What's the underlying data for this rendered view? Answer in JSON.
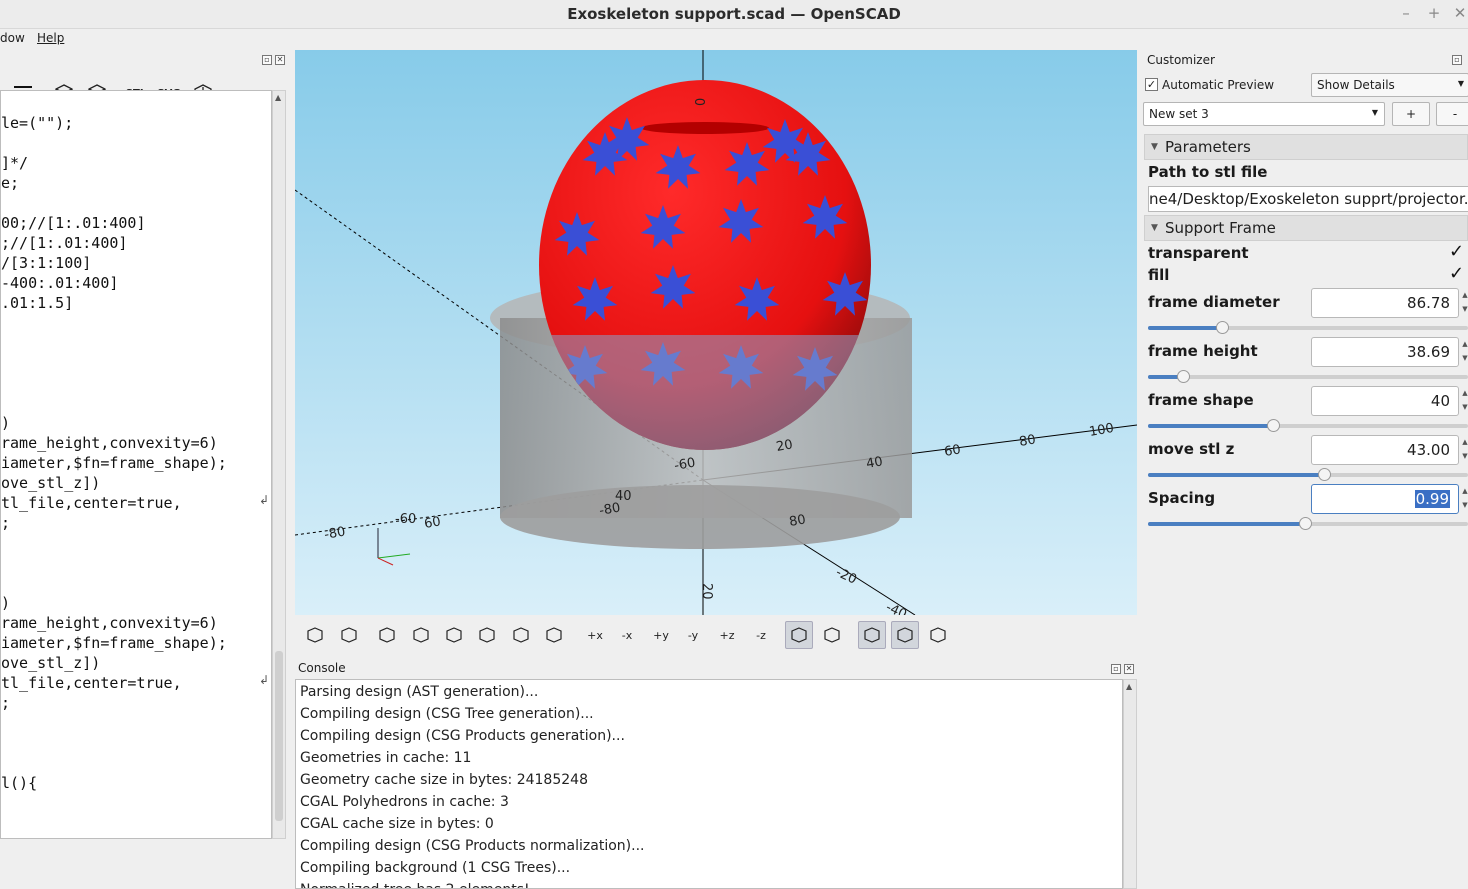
{
  "window": {
    "title": "Exoskeleton support.scad — OpenSCAD",
    "min_glyph": "–",
    "max_glyph": "+",
    "close_glyph": "✕"
  },
  "menu": {
    "items": [
      "dow",
      "Help"
    ]
  },
  "editor": {
    "toolbar": [
      "indent-icon",
      "preview-icon",
      "render-icon",
      "STL",
      "SVG",
      "send-icon"
    ],
    "lines": [
      "le=(\"\");",
      "",
      "]*/",
      "e;",
      "",
      "00;//[1:.01:400]",
      ";//[1:.01:400]",
      "/[3:1:100]",
      "-400:.01:400]",
      ".01:1.5]",
      "",
      "",
      "",
      "",
      "",
      ")",
      "rame_height,convexity=6)",
      "iameter,$fn=frame_shape);",
      "ove_stl_z])",
      "tl_file,center=true,",
      ";",
      "",
      "",
      "",
      ")",
      "rame_height,convexity=6)",
      "iameter,$fn=frame_shape);",
      "ove_stl_z])",
      "tl_file,center=true,",
      ";",
      "",
      "",
      "",
      "l(){"
    ],
    "wrap_glyph": "↲"
  },
  "viewport": {
    "background_top": "#87cbe9",
    "background_bottom": "#d9eff9",
    "axis_labels": [
      "0",
      "20",
      "40",
      "60",
      "80",
      "100",
      "20",
      "40",
      "60",
      "80",
      "-20",
      "-40",
      "-60",
      "-80",
      "-20",
      "-60",
      "-80"
    ],
    "sphere_color": "#ee1111",
    "star_color": "#3a4fd6",
    "cylinder_color": "#a9a9a9"
  },
  "view_toolbar": {
    "buttons": [
      "preview-icon",
      "render-icon",
      "view-all-icon",
      "zoom-in-icon",
      "zoom-out-icon",
      "reset-view-icon",
      "view-center-icon",
      "surface-icon",
      "+x",
      "-x",
      "+y",
      "-y",
      "+z",
      "-z",
      "perspective-icon",
      "orthogonal-icon",
      "axes-icon",
      "scale-markers-icon",
      "edges-icon"
    ]
  },
  "console": {
    "label": "Console",
    "lines": [
      "Parsing design (AST generation)...",
      "Compiling design (CSG Tree generation)...",
      "Compiling design (CSG Products generation)...",
      "Geometries in cache: 11",
      "Geometry cache size in bytes: 24185248",
      "CGAL Polyhedrons in cache: 3",
      "CGAL cache size in bytes: 0",
      "Compiling design (CSG Products normalization)...",
      "Compiling background (1 CSG Trees)...",
      "Normalized tree has 2 elements!"
    ]
  },
  "customizer": {
    "title": "Customizer",
    "auto_preview_label": "Automatic Preview",
    "auto_preview_checked": true,
    "details_combo": "Show Details",
    "preset_combo": "New set 3",
    "add_button": "+",
    "remove_button": "-",
    "sections": [
      {
        "title": "Parameters"
      },
      {
        "title": "Support Frame"
      }
    ],
    "path_label": "Path to stl file",
    "path_value": "ne4/Desktop/Exoskeleton supprt/projector.stl",
    "check_params": [
      {
        "label": "transparent",
        "checked": true
      },
      {
        "label": "fill",
        "checked": true
      }
    ],
    "check_glyph": "✓",
    "spin_up": "▲",
    "spin_down": "▼",
    "num_params": [
      {
        "label": "frame diameter",
        "value": "86.78",
        "level": 0.23
      },
      {
        "label": "frame height",
        "value": "38.69",
        "level": 0.11
      },
      {
        "label": "frame shape",
        "value": "40",
        "level": 0.39
      },
      {
        "label": "move stl z",
        "value": "43.00",
        "level": 0.55
      },
      {
        "label": "Spacing",
        "value": "0.99",
        "level": 0.49
      }
    ]
  }
}
